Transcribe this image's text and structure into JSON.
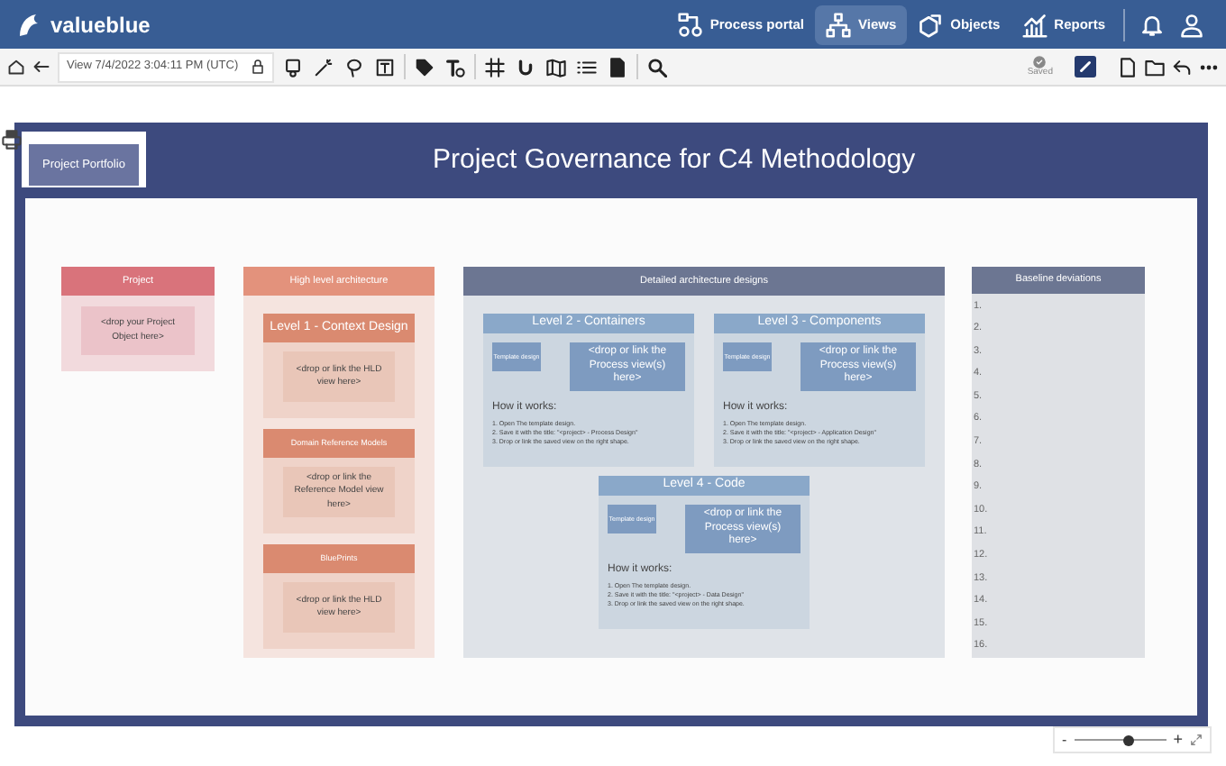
{
  "app_bar": {
    "brand": "valueblue",
    "nav": [
      {
        "label": "Process portal",
        "selected": false
      },
      {
        "label": "Views",
        "selected": true
      },
      {
        "label": "Objects",
        "selected": false
      },
      {
        "label": "Reports",
        "selected": false
      }
    ]
  },
  "toolbar": {
    "view_field": "View 7/4/2022 3:04:11 PM (UTC)",
    "save_status": "Saved"
  },
  "diagram": {
    "portfolio_button": "Project Portfolio",
    "title": "Project Governance for C4 Methodology",
    "project": {
      "header": "Project",
      "drop_hint": "<drop your Project Object here>"
    },
    "high_level": {
      "header": "High level architecture",
      "sections": [
        {
          "kind": "title",
          "header": "Level 1 - Context Design",
          "drop_hint": "<drop or link the HLD view here>"
        },
        {
          "kind": "label",
          "header": "Domain Reference Models",
          "drop_hint": "<drop or link the Reference Model view here>"
        },
        {
          "kind": "label",
          "header": "BluePrints",
          "drop_hint": "<drop or link the HLD view here>"
        }
      ]
    },
    "detailed": {
      "header": "Detailed architecture designs",
      "levels": [
        {
          "header": "Level 2 - Containers",
          "template": "Template design",
          "drop_hint": "<drop or link the Process view(s) here>",
          "how_title": "How it works:",
          "steps": [
            "1. Open The template design.",
            "2. Save it with the title: \"<project> - Process Design\"",
            "3. Drop or link the saved view on the right shape."
          ]
        },
        {
          "header": "Level 3 - Components",
          "template": "Template design",
          "drop_hint": "<drop or link the Process view(s) here>",
          "how_title": "How it works:",
          "steps": [
            "1. Open The template design.",
            "2. Save it with the title: \"<project> - Application Design\"",
            "3. Drop or link the saved view on the right shape."
          ]
        },
        {
          "header": "Level 4 - Code",
          "template": "Template design",
          "drop_hint": "<drop or link the Process view(s) here>",
          "how_title": "How it works:",
          "steps": [
            "1. Open The template design.",
            "2. Save it with the title: \"<project> - Data Design\"",
            "3. Drop or link the saved view on the right shape."
          ]
        }
      ]
    },
    "baseline": {
      "header": "Baseline deviations",
      "items": [
        "1.",
        "2.",
        "3.",
        "4.",
        "5.",
        "6.",
        "7.",
        "8.",
        "9.",
        "10.",
        "11.",
        "12.",
        "13.",
        "14.",
        "15.",
        "16."
      ]
    }
  },
  "zoom": {
    "zoom_out": "-",
    "zoom_in": "+",
    "level": 0.6
  }
}
